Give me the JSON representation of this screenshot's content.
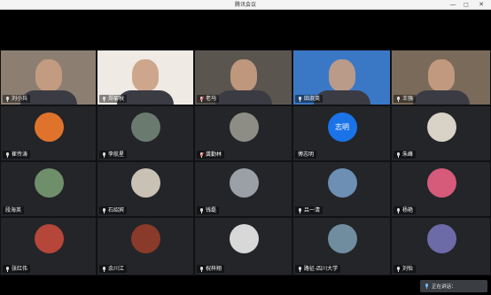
{
  "window": {
    "title": "腾讯会议",
    "controls": {
      "minimize": "—",
      "maximize": "□",
      "close": "✕"
    }
  },
  "participants": [
    {
      "name": "刘小兵",
      "mic": "on",
      "kind": "video",
      "bg": "#8c7f72"
    },
    {
      "name": "郑菊秋",
      "mic": "on",
      "kind": "video",
      "bg": "#efeae4"
    },
    {
      "name": "老马",
      "mic": "off",
      "kind": "video",
      "bg": "#5b5550"
    },
    {
      "name": "田淑英",
      "mic": "on",
      "kind": "video",
      "bg": "#3a78c6"
    },
    {
      "name": "王强",
      "mic": "on",
      "kind": "video",
      "bg": "#7a6a5a"
    },
    {
      "name": "崔传涛",
      "mic": "on",
      "kind": "avatar",
      "bg": "#e0732c"
    },
    {
      "name": "李航星",
      "mic": "on",
      "kind": "avatar",
      "bg": "#6b7a6e"
    },
    {
      "name": "龚勤林",
      "mic": "off",
      "kind": "avatar",
      "bg": "#8d8d86"
    },
    {
      "name": "傅志明",
      "mic": "none",
      "kind": "text",
      "avatar_text": "志明",
      "bg": "#1a73e8"
    },
    {
      "name": "朱峰",
      "mic": "on",
      "kind": "avatar",
      "bg": "#d9d2c6"
    },
    {
      "name": "段海英",
      "mic": "none",
      "kind": "avatar",
      "bg": "#6f8f6b"
    },
    {
      "name": "石绍宾",
      "mic": "on",
      "kind": "avatar",
      "bg": "#c9c1b3"
    },
    {
      "name": "钱磊",
      "mic": "on",
      "kind": "avatar",
      "bg": "#9aa0a6"
    },
    {
      "name": "吕一清",
      "mic": "on",
      "kind": "avatar",
      "bg": "#6c8fb3"
    },
    {
      "name": "杨艳",
      "mic": "on",
      "kind": "avatar",
      "bg": "#d65a7a"
    },
    {
      "name": "张红伟",
      "mic": "on",
      "kind": "avatar",
      "bg": "#b6453a"
    },
    {
      "name": "余川江",
      "mic": "on",
      "kind": "avatar",
      "bg": "#8a3a2a"
    },
    {
      "name": "祝梓翔",
      "mic": "on",
      "kind": "avatar",
      "bg": "#d8d8d8"
    },
    {
      "name": "路征-四川大学",
      "mic": "on",
      "kind": "avatar",
      "bg": "#6f8d9f"
    },
    {
      "name": "刘怡",
      "mic": "on",
      "kind": "avatar",
      "bg": "#6d6aa8"
    }
  ],
  "status": {
    "speaking_label": "正在讲话："
  },
  "colors": {
    "accent": "#1a73e8",
    "tile": "#232529",
    "grid": "#15171a"
  }
}
